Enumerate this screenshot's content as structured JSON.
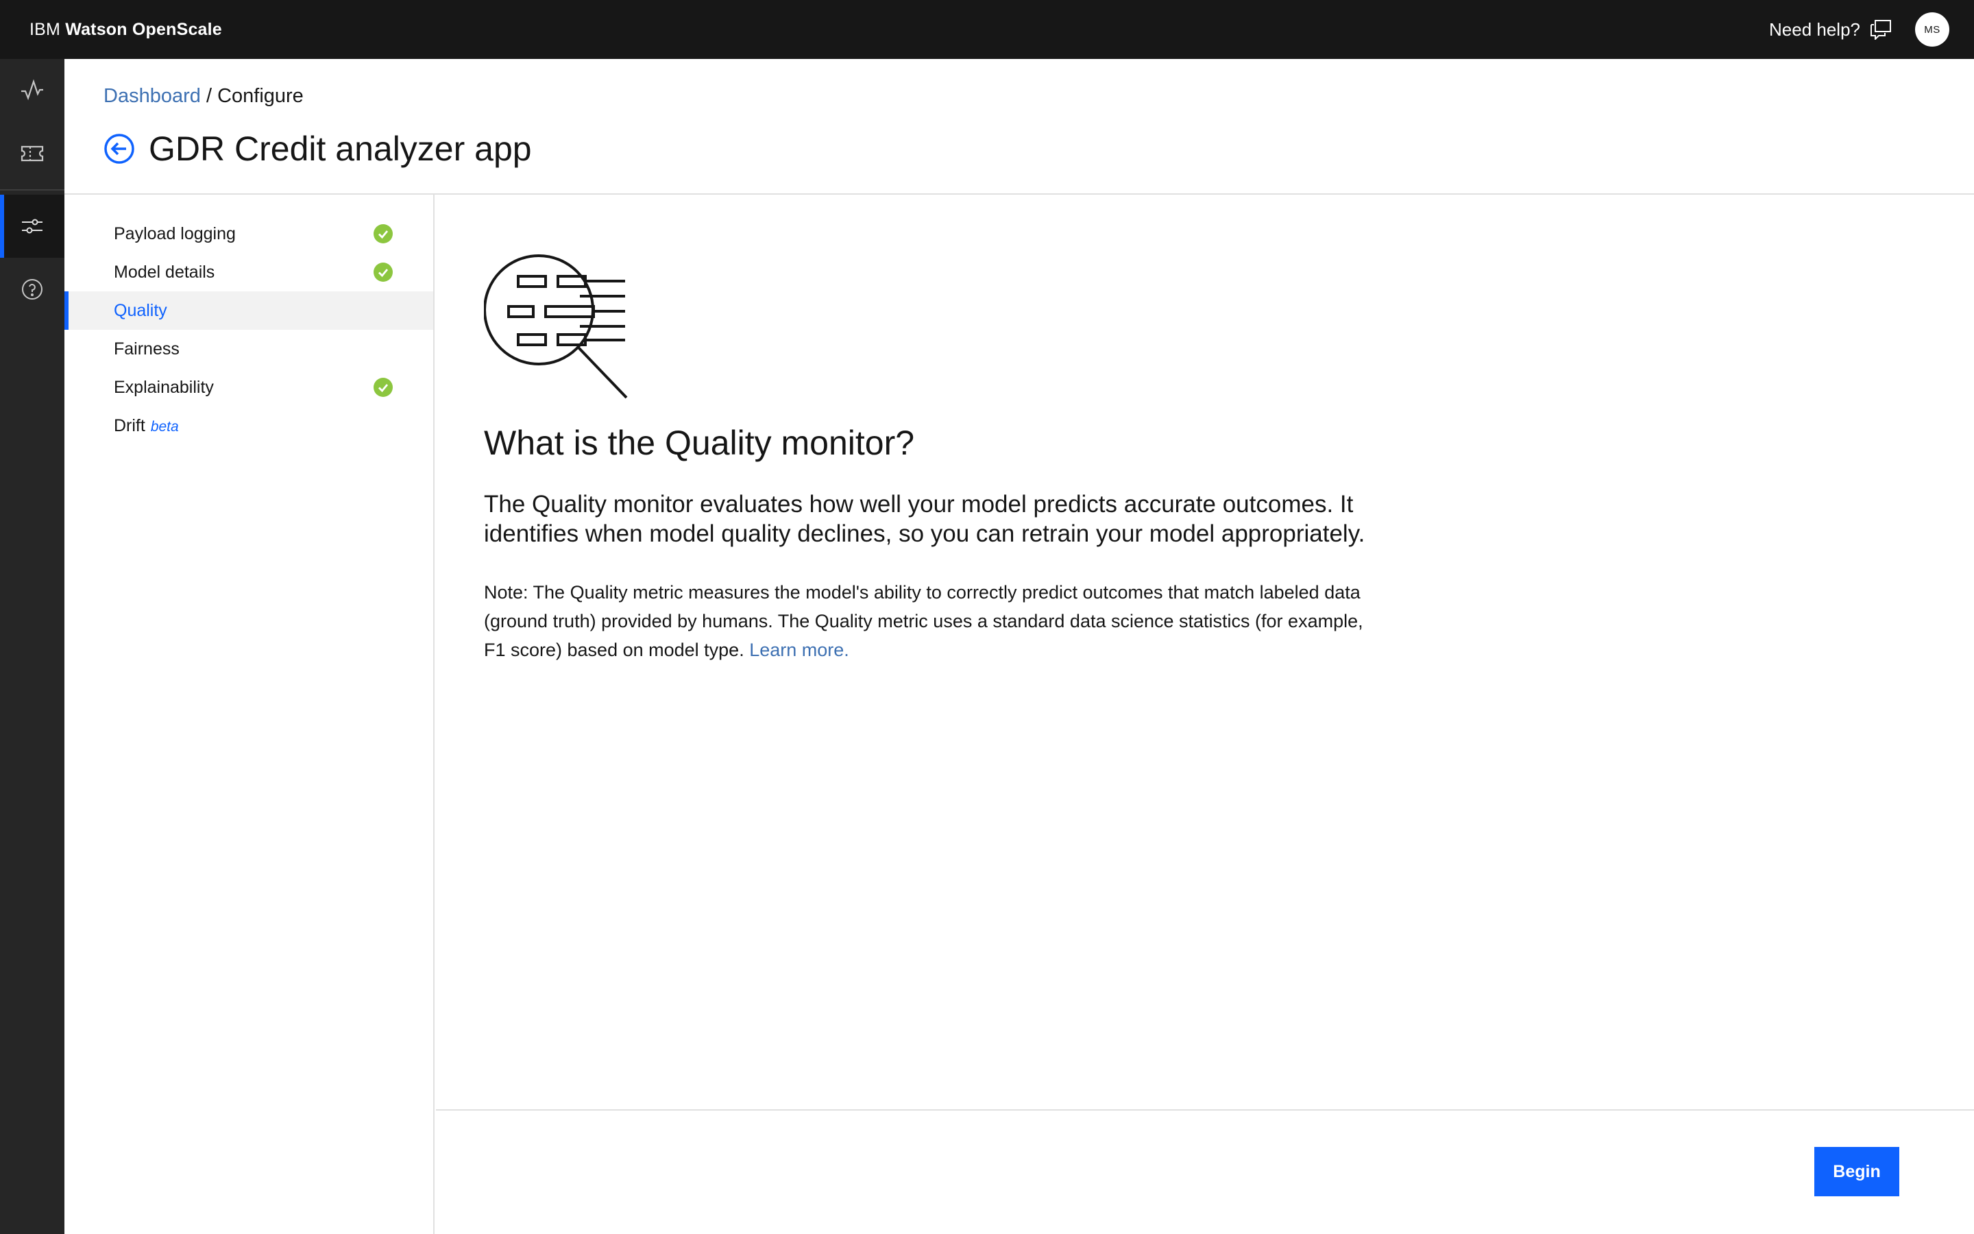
{
  "app": {
    "brand_ibm": "IBM",
    "brand_product": "Watson OpenScale",
    "help_label": "Need help?",
    "avatar_initials": "MS"
  },
  "rail": {
    "items": [
      {
        "icon": "activity-icon"
      },
      {
        "icon": "ticket-icon"
      },
      {
        "icon": "sliders-icon",
        "active": true
      },
      {
        "icon": "help-circle-icon"
      }
    ]
  },
  "breadcrumb": {
    "link": "Dashboard",
    "separator": "/",
    "current": "Configure"
  },
  "page": {
    "title": "GDR Credit analyzer app"
  },
  "config_nav": {
    "items": [
      {
        "label": "Payload logging",
        "complete": true
      },
      {
        "label": "Model details",
        "complete": true
      },
      {
        "label": "Quality",
        "complete": false,
        "selected": true
      },
      {
        "label": "Fairness",
        "complete": false
      },
      {
        "label": "Explainability",
        "complete": true
      },
      {
        "label": "Drift",
        "badge": "beta",
        "complete": false
      }
    ]
  },
  "content": {
    "title": "What is the Quality monitor?",
    "lead": "The Quality monitor evaluates how well your model predicts accurate outcomes. It identifies when model quality declines, so you can retrain your model appropriately.",
    "note": "Note: The Quality metric measures the model's ability to correctly predict outcomes that match labeled data (ground truth) provided by humans. The Quality metric uses a standard data science statistics (for example, F1 score) based on model type.",
    "learn_more": "Learn more."
  },
  "footer": {
    "begin_label": "Begin"
  },
  "colors": {
    "topbar": "#171717",
    "rail": "#262626",
    "accent": "#0f62fe",
    "link": "#3d70b2",
    "success": "#8cc63f"
  }
}
